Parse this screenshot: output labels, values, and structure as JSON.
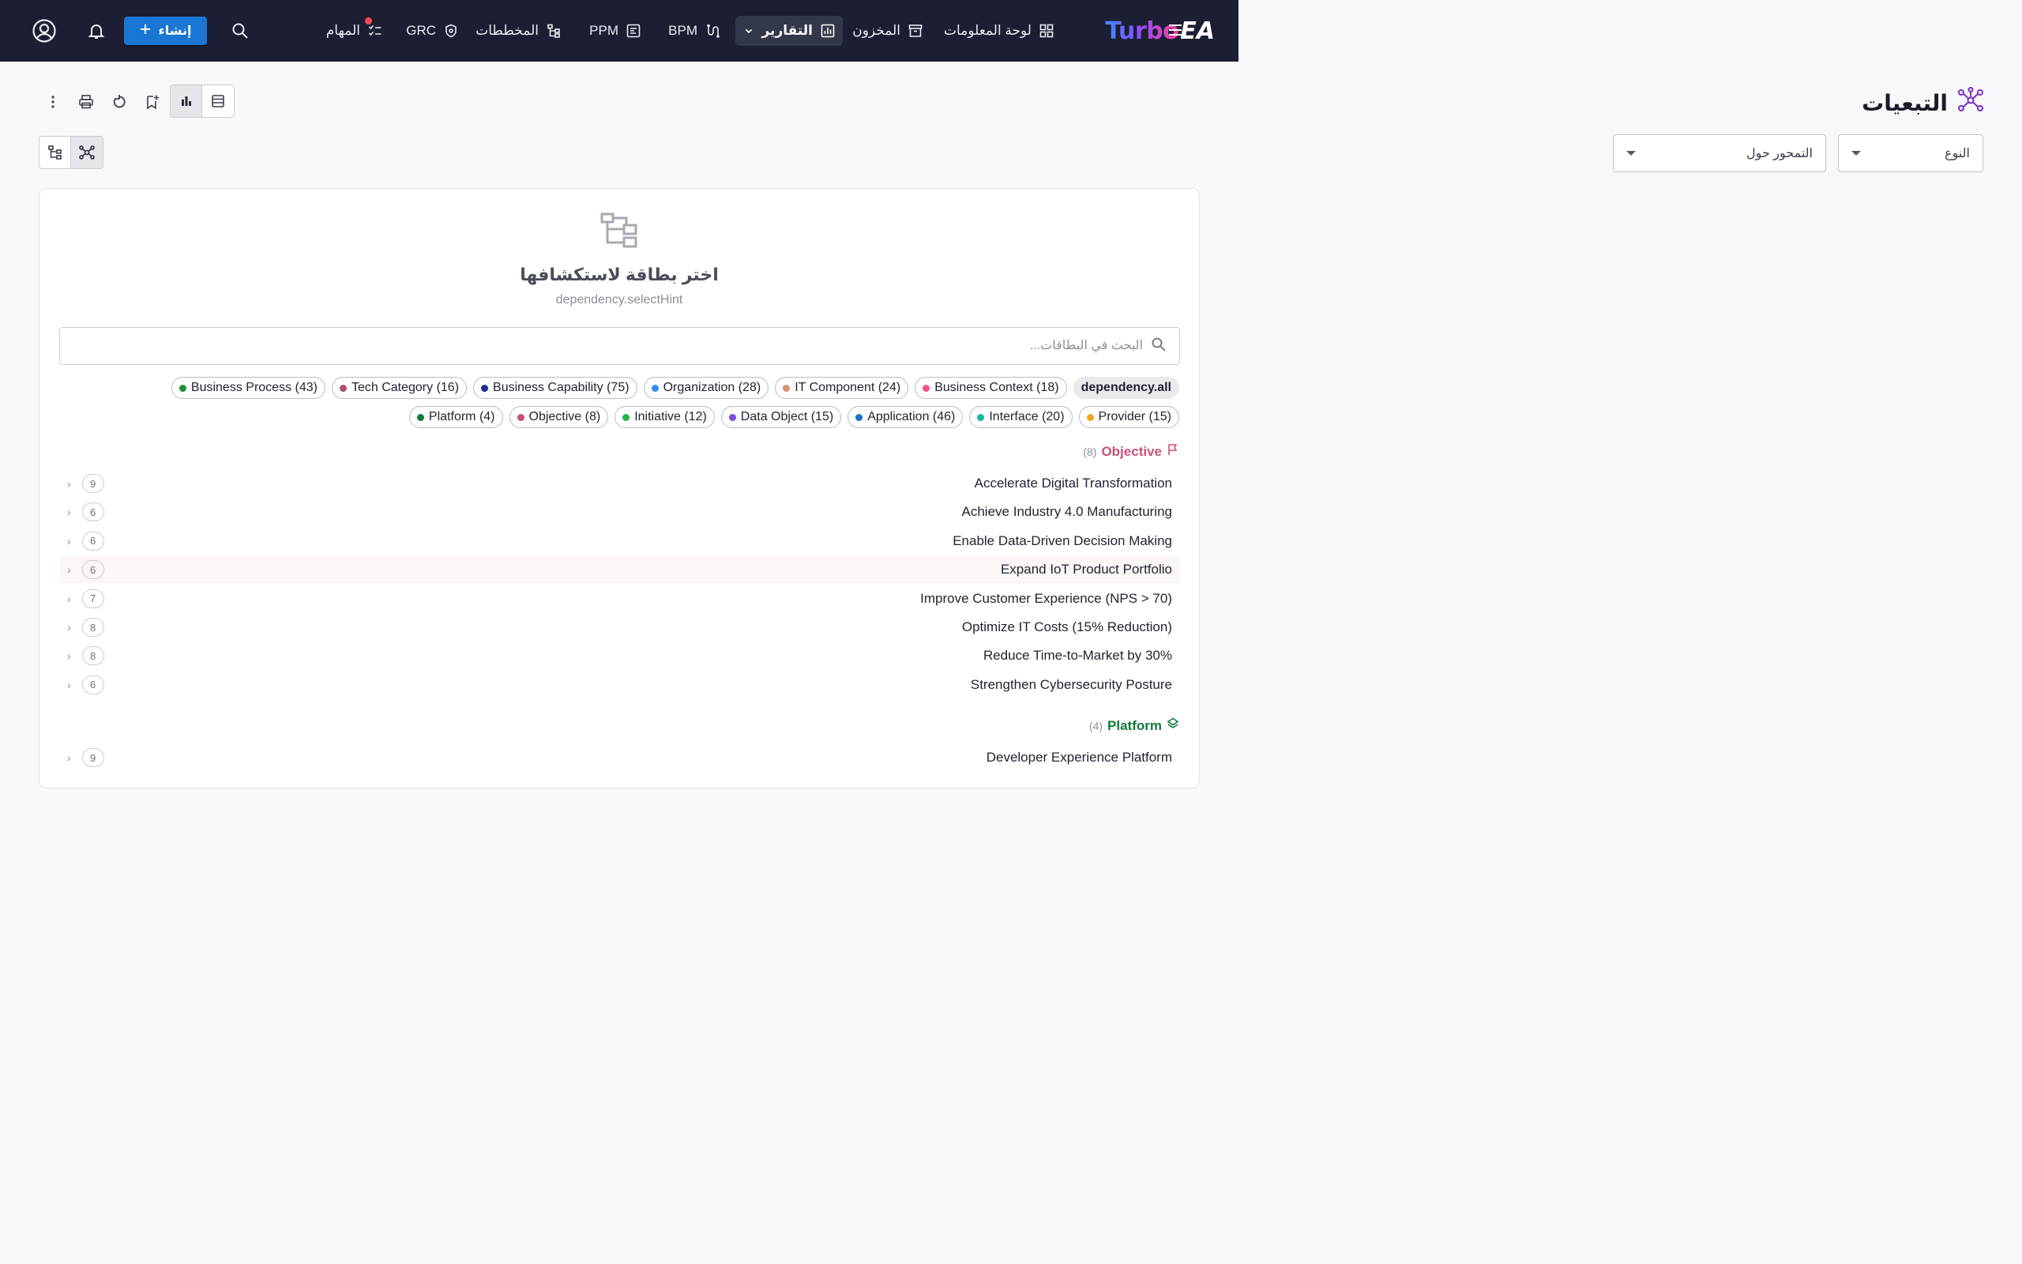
{
  "topbar": {
    "logo_main": "Turbo",
    "logo_suffix": "EA",
    "nav": [
      {
        "label": "لوحة المعلومات"
      },
      {
        "label": "المخزون"
      },
      {
        "label": "التقارير"
      },
      {
        "label": "BPM"
      },
      {
        "label": "PPM"
      },
      {
        "label": "المخططات"
      },
      {
        "label": "GRC"
      },
      {
        "label": "المهام"
      }
    ],
    "create_label": "إنشاء"
  },
  "page": {
    "title": "التبعيات"
  },
  "filters": {
    "type_label": "النوع",
    "pivot_label": "التمحور حول"
  },
  "empty_state": {
    "title": "اختر بطاقة لاستكشافها",
    "hint": "dependency.selectHint"
  },
  "search": {
    "placeholder": "البحث في البطاقات..."
  },
  "chips_row1": [
    {
      "label": "dependency.all",
      "color": ""
    },
    {
      "label": "Business Context (18)",
      "color": "#f0508a"
    },
    {
      "label": "IT Component (24)",
      "color": "#d9906e"
    },
    {
      "label": "Organization (28)",
      "color": "#2f8ff0"
    },
    {
      "label": "Business Capability (75)",
      "color": "#1b2e8f"
    },
    {
      "label": "Tech Category (16)",
      "color": "#a85168"
    },
    {
      "label": "Business Process (43)",
      "color": "#1d8f3a"
    }
  ],
  "chips_row2": [
    {
      "label": "Provider (15)",
      "color": "#f5a623"
    },
    {
      "label": "Interface (20)",
      "color": "#14b8a6"
    },
    {
      "label": "Application (46)",
      "color": "#1e73c8"
    },
    {
      "label": "Data Object (15)",
      "color": "#7c4dd8"
    },
    {
      "label": "Initiative (12)",
      "color": "#25b449"
    },
    {
      "label": "Objective (8)",
      "color": "#c8507a"
    },
    {
      "label": "Platform (4)",
      "color": "#0f7a3a"
    }
  ],
  "groups": {
    "objective": {
      "name": "Objective",
      "count": "(8)",
      "color": "#c8507a",
      "items": [
        {
          "label": "Accelerate Digital Transformation",
          "count": "9"
        },
        {
          "label": "Achieve Industry 4.0 Manufacturing",
          "count": "6"
        },
        {
          "label": "Enable Data-Driven Decision Making",
          "count": "6"
        },
        {
          "label": "Expand IoT Product Portfolio",
          "count": "6"
        },
        {
          "label": "Improve Customer Experience (NPS > 70)",
          "count": "7"
        },
        {
          "label": "Optimize IT Costs (15% Reduction)",
          "count": "8"
        },
        {
          "label": "Reduce Time-to-Market by 30%",
          "count": "8"
        },
        {
          "label": "Strengthen Cybersecurity Posture",
          "count": "6"
        }
      ]
    },
    "platform": {
      "name": "Platform",
      "count": "(4)",
      "color": "#0f7a3a",
      "items": [
        {
          "label": "Developer Experience Platform",
          "count": "9"
        }
      ]
    }
  }
}
